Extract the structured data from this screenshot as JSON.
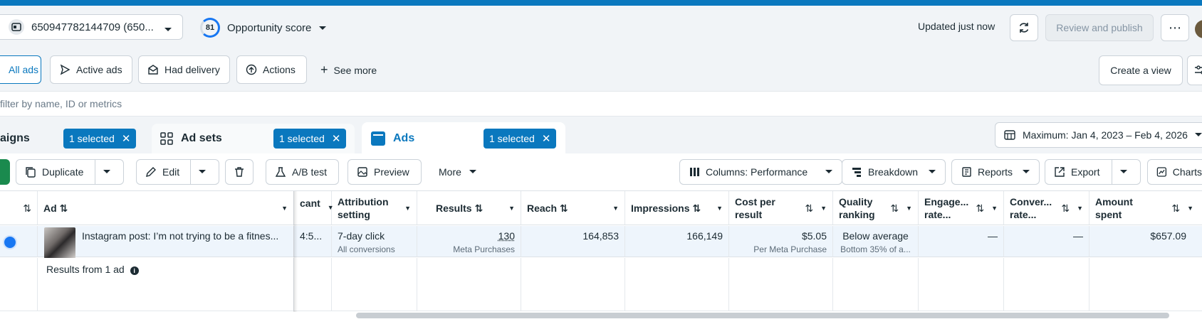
{
  "header": {
    "account_label": "650947782144709 (650...",
    "opportunity_score": "81",
    "opportunity_label": "Opportunity score",
    "updated_text": "Updated just now",
    "review_label": "Review and publish",
    "more_label": "⋯"
  },
  "filters": {
    "chips": [
      {
        "label": "All ads"
      },
      {
        "label": "Active ads"
      },
      {
        "label": "Had delivery"
      },
      {
        "label": "Actions"
      }
    ],
    "see_more": "See more",
    "create_view": "Create a view"
  },
  "search": {
    "placeholder": "filter by name, ID or metrics"
  },
  "levels": {
    "campaigns_label": "aigns",
    "campaigns_badge": "1 selected",
    "adsets_label": "Ad sets",
    "adsets_badge": "1 selected",
    "ads_label": "Ads",
    "ads_badge": "1 selected",
    "date_range": "Maximum: Jan 4, 2023 – Feb 4, 2026"
  },
  "toolbar": {
    "duplicate": "Duplicate",
    "edit": "Edit",
    "ab_test": "A/B test",
    "preview": "Preview",
    "more": "More",
    "columns": "Columns: Performance",
    "breakdown": "Breakdown",
    "reports": "Reports",
    "export": "Export",
    "charts": "Charts"
  },
  "table": {
    "headers": {
      "ad": "Ad",
      "cant": "cant",
      "attribution": "Attribution setting",
      "results": "Results",
      "reach": "Reach",
      "impressions": "Impressions",
      "cost_per_result": "Cost per result",
      "quality_ranking": "Quality ranking",
      "engagement": "Engage... rate...",
      "conversion": "Conver... rate...",
      "amount_spent": "Amount spent"
    },
    "row": {
      "ad_name": "Instagram post: I’m not trying to be a fitnes...",
      "cant": "4:5...",
      "attribution": "7-day click",
      "attribution_sub": "All conversions",
      "results": "130",
      "results_sub": "Meta Purchases",
      "reach": "164,853",
      "impressions": "166,149",
      "cost_per_result": "$5.05",
      "cost_sub": "Per Meta Purchase",
      "quality_ranking": "Below average",
      "quality_sub": "Bottom 35% of a...",
      "engagement": "—",
      "conversion": "—",
      "amount_spent": "$657.09"
    },
    "summary": "Results from 1 ad"
  }
}
